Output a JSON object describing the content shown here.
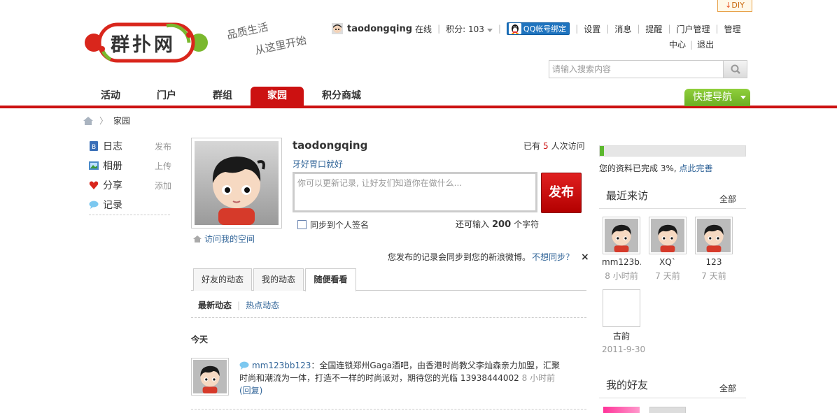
{
  "diy": {
    "label": "DIY"
  },
  "logo": {
    "text": "群扑网"
  },
  "slogan": {
    "line1": "品质生活",
    "line2": "从这里开始"
  },
  "userbar": {
    "username": "taodongqing",
    "online": "在线",
    "points": "积分: 103",
    "qq_bind": "QQ帐号绑定",
    "links": [
      "设置",
      "消息",
      "提醒",
      "门户管理",
      "管理"
    ],
    "links2": [
      "中心",
      "退出"
    ]
  },
  "search": {
    "placeholder": "请输入搜索内容"
  },
  "nav": {
    "items": [
      "活动",
      "门户",
      "群组",
      "家园",
      "积分商城"
    ],
    "quick": "快捷导航"
  },
  "breadcrumb": {
    "current": "家园"
  },
  "leftmenu": {
    "items": [
      {
        "label": "日志",
        "action": "发布"
      },
      {
        "label": "相册",
        "action": "上传"
      },
      {
        "label": "分享",
        "action": "添加"
      },
      {
        "label": "记录",
        "action": ""
      }
    ]
  },
  "profile": {
    "username": "taodongqing",
    "motto": "牙好胃口就好",
    "visits_prefix": "已有",
    "visits_num": "5",
    "visits_suffix": "人次访问",
    "visit_space": "访问我的空间",
    "status_placeholder": "你可以更新记录, 让好友们知道你在做什么...",
    "publish": "发布",
    "sync_sign": "同步到个人签名",
    "remaining_prefix": "还可输入",
    "remaining_num": "200",
    "remaining_suffix": "个字符",
    "weibo_note": "您发布的记录会同步到您的新浪微博。",
    "weibo_link": "不想同步？",
    "close": "×"
  },
  "tabs": [
    "好友的动态",
    "我的动态",
    "随便看看"
  ],
  "subtabs": {
    "latest": "最新动态",
    "hot": "热点动态"
  },
  "feed": {
    "day": "今天",
    "user": "mm123bb123",
    "text": "：全国连锁郑州Gaga酒吧，由香港时尚教父李灿森亲力加盟，汇聚时尚和潮流为一体，打造不一样的时尚派对，期待您的光临 13938444002",
    "time": "8 小时前",
    "reply": "(回复)"
  },
  "right": {
    "progress_percent": 3,
    "complete_text": "您的资料已完成 3%,",
    "complete_link": "点此完善",
    "recent_title": "最近来访",
    "recent_all": "全部",
    "visitors": [
      {
        "name": "mm123b…",
        "time": "8 小时前"
      },
      {
        "name": "XQ`",
        "time": "7 天前"
      },
      {
        "name": "123",
        "time": "7 天前"
      },
      {
        "name": "古韵",
        "time": "2011-9-30"
      }
    ],
    "friends_title": "我的好友",
    "friends_all": "全部"
  },
  "colors": {
    "brand_red": "#cc1111",
    "quick_green": "#6cae22",
    "link": "#336699"
  }
}
